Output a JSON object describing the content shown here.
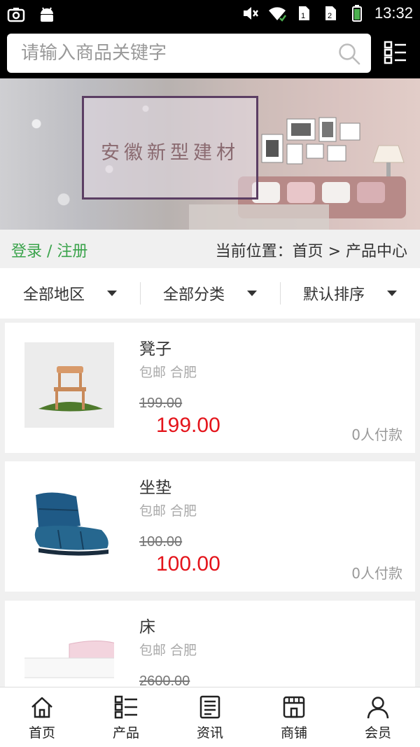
{
  "status_bar": {
    "time": "13:32",
    "left_icons": [
      "screenshot-icon",
      "android-icon"
    ],
    "right_icons": [
      "mute-icon",
      "wifi-icon",
      "sim1-icon",
      "sim2-icon",
      "battery-icon"
    ]
  },
  "search": {
    "placeholder": "请输入商品关键字",
    "icon": "search-icon",
    "menu_icon": "category-menu-icon"
  },
  "banner": {
    "title": "安徽新型建材"
  },
  "breadcrumb": {
    "login_label": "登录 / 注册",
    "location_text": "当前位置：首页 > 产品中心"
  },
  "filters": [
    {
      "label": "全部地区"
    },
    {
      "label": "全部分类"
    },
    {
      "label": "默认排序"
    }
  ],
  "products": [
    {
      "name": "凳子",
      "shipping": "包邮 合肥",
      "original_price": "199.00",
      "price": "199.00",
      "paid": "0人付款"
    },
    {
      "name": "坐垫",
      "shipping": "包邮 合肥",
      "original_price": "100.00",
      "price": "100.00",
      "paid": "0人付款"
    },
    {
      "name": "床",
      "shipping": "包邮 合肥",
      "original_price": "2600.00",
      "price": "",
      "paid": ""
    }
  ],
  "bottom_nav": [
    {
      "label": "首页",
      "icon": "home-icon"
    },
    {
      "label": "产品",
      "icon": "product-grid-icon"
    },
    {
      "label": "资讯",
      "icon": "news-icon"
    },
    {
      "label": "商铺",
      "icon": "store-icon"
    },
    {
      "label": "会员",
      "icon": "member-icon"
    }
  ],
  "colors": {
    "accent_green": "#3aa34b",
    "price_red": "#e4141b",
    "header_bg": "#000000"
  }
}
